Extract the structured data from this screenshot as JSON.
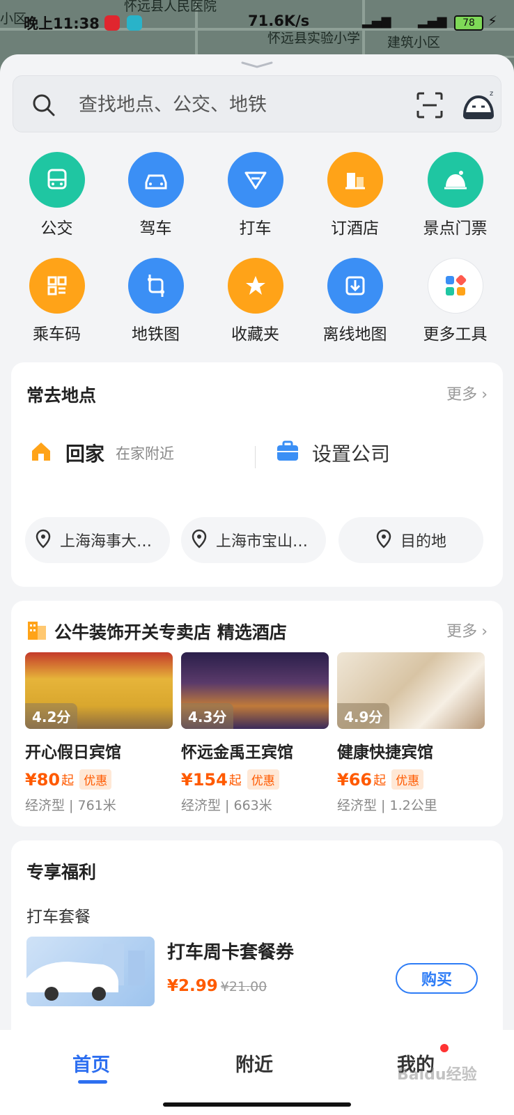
{
  "status_bar": {
    "time": "晚上11:38",
    "speed": "71.6K/s",
    "battery": "78"
  },
  "map": {
    "labels": [
      "小区",
      "怀远县人民医院",
      "怀远县实验小学",
      "建筑小区"
    ]
  },
  "search": {
    "placeholder": "查找地点、公交、地铁"
  },
  "shortcuts": [
    {
      "label": "公交",
      "icon": "bus-icon",
      "color": "#1fc6a2"
    },
    {
      "label": "驾车",
      "icon": "car-icon",
      "color": "#3b8ff5"
    },
    {
      "label": "打车",
      "icon": "taxi-icon",
      "color": "#3b8ff5"
    },
    {
      "label": "订酒店",
      "icon": "hotel-icon",
      "color": "#ffa318"
    },
    {
      "label": "景点门票",
      "icon": "ticket-icon",
      "color": "#1fc6a2"
    },
    {
      "label": "乘车码",
      "icon": "qr-icon",
      "color": "#ffa318"
    },
    {
      "label": "地铁图",
      "icon": "subway-icon",
      "color": "#3b8ff5"
    },
    {
      "label": "收藏夹",
      "icon": "star-icon",
      "color": "#ffa318"
    },
    {
      "label": "离线地图",
      "icon": "download-icon",
      "color": "#3b8ff5"
    },
    {
      "label": "更多工具",
      "icon": "apps-icon",
      "color": "#ffffff"
    }
  ],
  "frequent": {
    "title": "常去地点",
    "more": "更多",
    "home": {
      "name": "回家",
      "sub": "在家附近"
    },
    "company": {
      "name": "设置公司"
    },
    "chips": [
      "上海海事大…",
      "上海市宝山…",
      "目的地"
    ]
  },
  "hotels": {
    "title": "公牛装饰开关专卖店 精选酒店",
    "more": "更多",
    "items": [
      {
        "score": "4.2分",
        "name": "开心假日宾馆",
        "price": "¥80",
        "unit": "起",
        "badge": "优惠",
        "meta": "经济型 | 761米"
      },
      {
        "score": "4.3分",
        "name": "怀远金禹王宾馆",
        "price": "¥154",
        "unit": "起",
        "badge": "优惠",
        "meta": "经济型 | 663米"
      },
      {
        "score": "4.9分",
        "name": "健康快捷宾馆",
        "price": "¥66",
        "unit": "起",
        "badge": "优惠",
        "meta": "经济型 | 1.2公里"
      }
    ]
  },
  "perks": {
    "title": "专享福利",
    "subtitle": "打车套餐",
    "item": {
      "title": "打车周卡套餐券",
      "price": "¥2.99",
      "old_price": "¥21.00",
      "button": "购买"
    }
  },
  "bottom_nav": {
    "tabs": [
      "首页",
      "附近",
      "我的"
    ],
    "active": 0,
    "watermark": "Baidu经验"
  }
}
